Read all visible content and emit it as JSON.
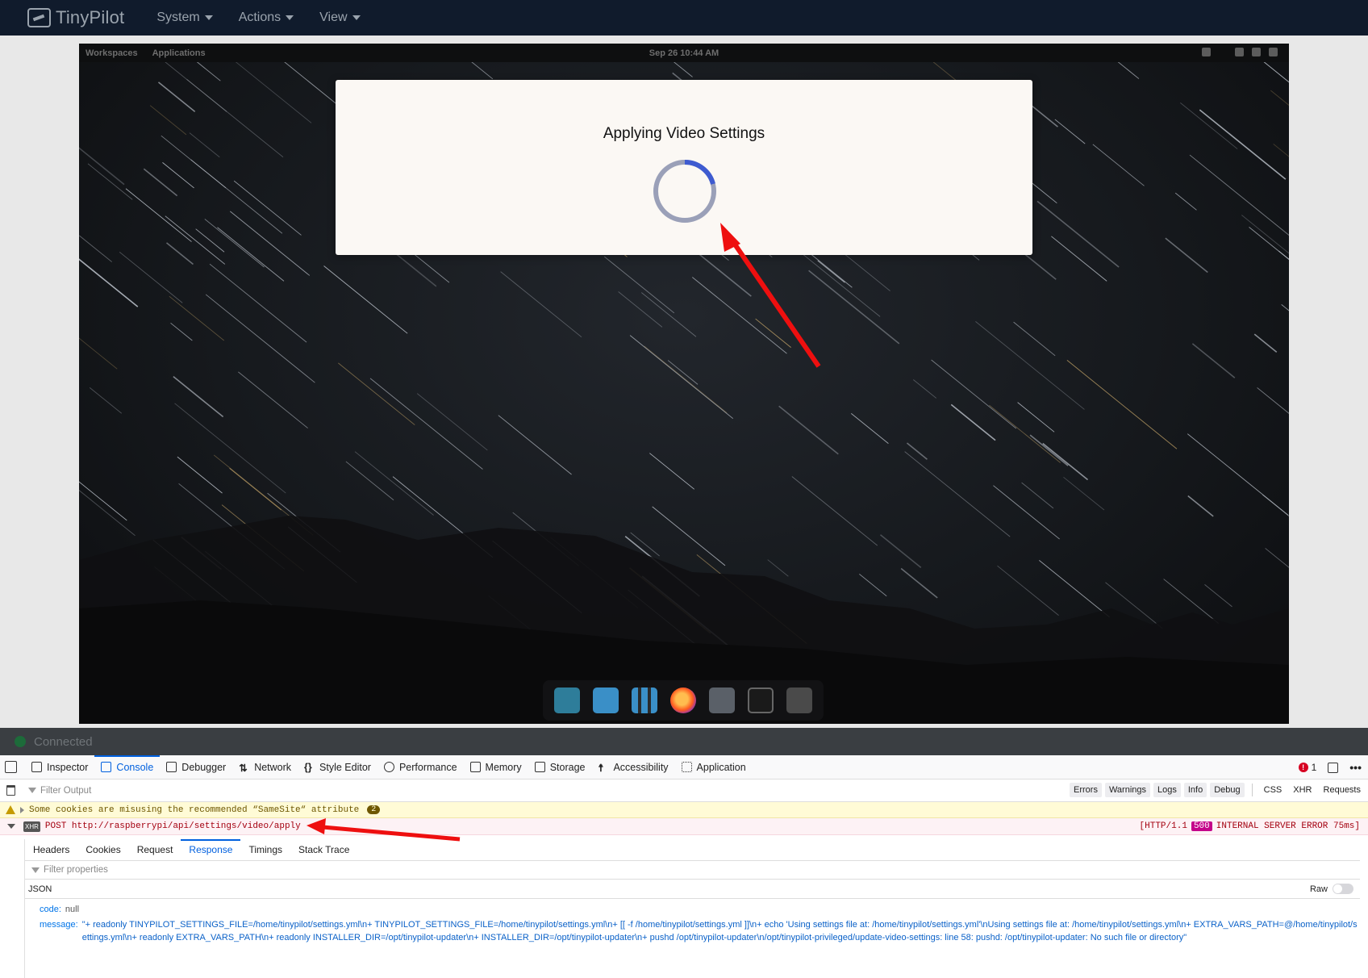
{
  "app": {
    "logo_text": "TinyPilot",
    "menu": [
      {
        "label": "System"
      },
      {
        "label": "Actions"
      },
      {
        "label": "View"
      }
    ]
  },
  "remote": {
    "topbar": {
      "workspaces": "Workspaces",
      "applications": "Applications",
      "clock": "Sep 26  10:44 AM"
    },
    "modal": {
      "title": "Applying Video Settings"
    },
    "dock_icons": [
      "search-icon",
      "workspaces-icon",
      "app-grid-icon",
      "firefox-icon",
      "files-icon",
      "terminal-icon",
      "settings-icon"
    ]
  },
  "status": {
    "text": "Connected"
  },
  "devtools": {
    "tabs": [
      {
        "label": "Inspector",
        "icon": "inspector-icon"
      },
      {
        "label": "Console",
        "icon": "console-icon"
      },
      {
        "label": "Debugger",
        "icon": "debugger-icon"
      },
      {
        "label": "Network",
        "icon": "network-icon"
      },
      {
        "label": "Style Editor",
        "icon": "style-editor-icon"
      },
      {
        "label": "Performance",
        "icon": "performance-icon"
      },
      {
        "label": "Memory",
        "icon": "memory-icon"
      },
      {
        "label": "Storage",
        "icon": "storage-icon"
      },
      {
        "label": "Accessibility",
        "icon": "accessibility-icon"
      },
      {
        "label": "Application",
        "icon": "application-icon"
      }
    ],
    "active_tab": "Console",
    "error_count": "1",
    "filter_placeholder": "Filter Output",
    "filter_buttons": [
      "Errors",
      "Warnings",
      "Logs",
      "Info",
      "Debug"
    ],
    "filter_plain": [
      "CSS",
      "XHR",
      "Requests"
    ],
    "warning": {
      "text": "Some cookies are misusing the recommended “SameSite“ attribute",
      "count": "2"
    },
    "xhr": {
      "tag": "XHR",
      "method_url": "POST http://raspberrypi/api/settings/video/apply",
      "status_prefix": "[HTTP/1.1",
      "status_code": "500",
      "status_suffix": "INTERNAL SERVER ERROR 75ms]"
    },
    "response_tabs": [
      "Headers",
      "Cookies",
      "Request",
      "Response",
      "Timings",
      "Stack Trace"
    ],
    "active_response_tab": "Response",
    "filter_properties": "Filter properties",
    "json_label": "JSON",
    "raw_label": "Raw",
    "json": {
      "code_key": "code:",
      "code_value": "null",
      "message_key": "message:",
      "message_value": "\"+ readonly TINYPILOT_SETTINGS_FILE=/home/tinypilot/settings.yml\\n+ TINYPILOT_SETTINGS_FILE=/home/tinypilot/settings.yml\\n+ [[ -f /home/tinypilot/settings.yml ]]\\n+ echo 'Using settings file at: /home/tinypilot/settings.yml'\\nUsing settings file at: /home/tinypilot/settings.yml\\n+ EXTRA_VARS_PATH=@/home/tinypilot/settings.yml\\n+ readonly EXTRA_VARS_PATH\\n+ readonly INSTALLER_DIR=/opt/tinypilot-updater\\n+ INSTALLER_DIR=/opt/tinypilot-updater\\n+ pushd /opt/tinypilot-updater\\n/opt/tinypilot-privileged/update-video-settings: line 58: pushd: /opt/tinypilot-updater: No such file or directory\""
    }
  }
}
